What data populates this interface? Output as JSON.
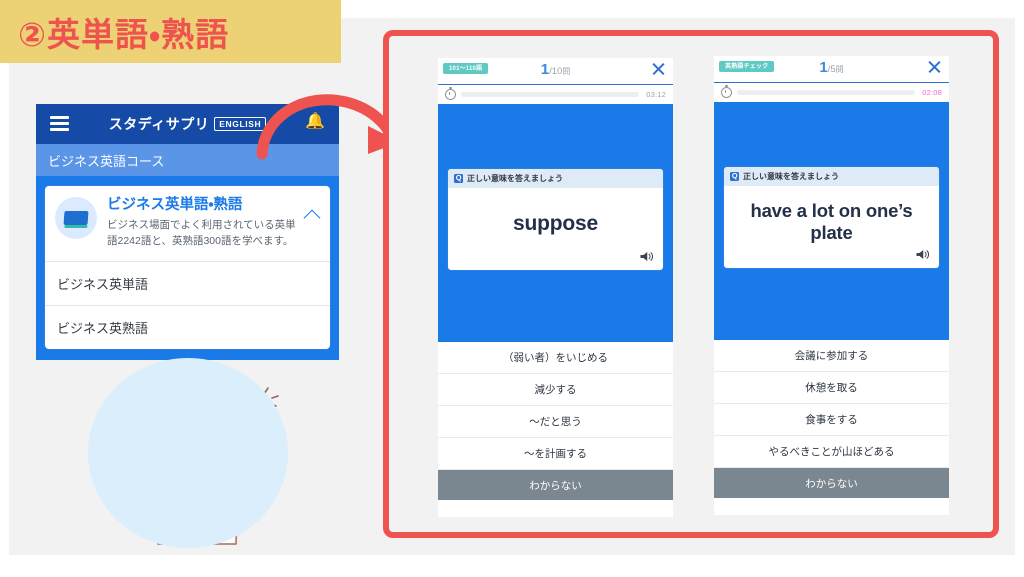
{
  "slide": {
    "title": "②英単語・熟語",
    "accent_red": "#ef5350",
    "band_yellow": "#ecd274",
    "brand_blue": "#1a7ae8"
  },
  "app": {
    "header": {
      "menu_icon": "hamburger-icon",
      "brand": "スタディサプリ",
      "brand_badge": "ENGLISH",
      "bell_icon": "bell-icon"
    },
    "course_bar": "ビジネス英語コース",
    "card": {
      "icon": "book-icon",
      "title": "ビジネス英単語・熟語",
      "description": "ビジネス場面でよく利用されている英単語2242語と、英熟語300語を学べます。",
      "collapse_icon": "chevron-up-icon",
      "rows": [
        "ビジネス英単語",
        "ビジネス英熟語"
      ]
    }
  },
  "illustration": {
    "name": "woman-pointing-illustration",
    "disc_color": "#dbeefb"
  },
  "arrow": {
    "name": "curved-arrow",
    "color": "#ef5350"
  },
  "screens": [
    {
      "id": "screen-vocab",
      "badge": "101〜110語",
      "badge_color": "#5fc9c4",
      "counter_current": "1",
      "counter_total": "/10",
      "counter_unit": "問",
      "close_icon": "close-icon",
      "timer_icon": "stopwatch-icon",
      "timer_value": "03:12",
      "timer_progress": 66,
      "timer_color": "#3fc0bd",
      "prompt_icon": "question-icon",
      "prompt": "正しい意味を答えましょう",
      "word": "suppose",
      "speaker_icon": "speaker-icon",
      "options": [
        "（弱い者）をいじめる",
        "減少する",
        "〜だと思う",
        "〜を計画する"
      ],
      "dunno_label": "わからない"
    },
    {
      "id": "screen-idiom",
      "badge": "英熟語チェック",
      "badge_color": "#5fc9c4",
      "counter_current": "1",
      "counter_total": "/5",
      "counter_unit": "問",
      "close_icon": "close-icon",
      "timer_icon": "stopwatch-icon",
      "timer_value": "02:08",
      "timer_progress": 44,
      "timer_color": "#e820d8",
      "prompt_icon": "question-icon",
      "prompt": "正しい意味を答えましょう",
      "word": "have a lot on one’s plate",
      "speaker_icon": "speaker-icon",
      "options": [
        "会議に参加する",
        "休憩を取る",
        "食事をする",
        "やるべきことが山ほどある"
      ],
      "dunno_label": "わからない"
    }
  ]
}
